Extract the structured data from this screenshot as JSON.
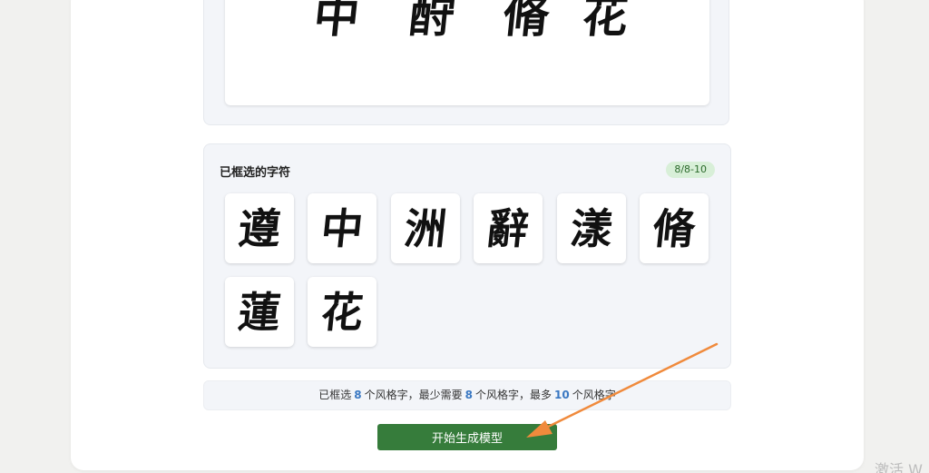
{
  "preview": {
    "chars": [
      "中",
      "酧",
      "脩",
      "花"
    ]
  },
  "selected": {
    "title": "已框选的字符",
    "badge": "8/8-10",
    "chars": [
      "遵",
      "中",
      "洲",
      "辭",
      "漾",
      "脩",
      "蓮",
      "花"
    ]
  },
  "info": {
    "part1": "已框选",
    "selected_count": "8",
    "part2": "个风格字，最少需要",
    "min_count": "8",
    "part3": "个风格字，最多",
    "max_count": "10",
    "part4": "个风格字"
  },
  "actions": {
    "start_label": "开始生成模型"
  },
  "annotation": {
    "arrow_color": "#f08a3c"
  },
  "watermark": {
    "text": "激活 W"
  }
}
